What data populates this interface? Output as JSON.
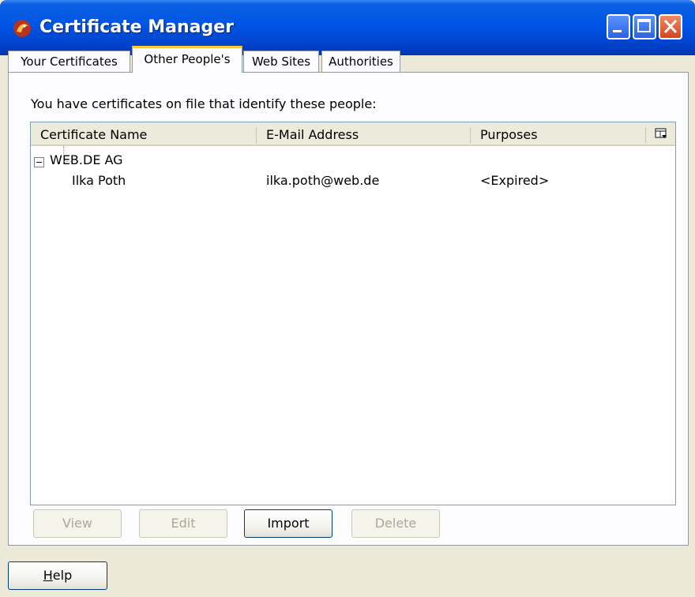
{
  "window": {
    "title": "Certificate Manager",
    "icon": "app-dragon-icon",
    "controls": {
      "minimize": "minimize-icon",
      "maximize": "maximize-icon",
      "close": "close-icon"
    }
  },
  "tabs": [
    {
      "label": "Your Certificates",
      "active": false
    },
    {
      "label": "Other People's",
      "active": true
    },
    {
      "label": "Web Sites",
      "active": false
    },
    {
      "label": "Authorities",
      "active": false
    }
  ],
  "panel": {
    "intro": "You have certificates on file that identify these people:",
    "columns": [
      {
        "label": "Certificate Name"
      },
      {
        "label": "E-Mail Address"
      },
      {
        "label": "Purposes"
      }
    ],
    "column_picker_icon": "column-picker-icon",
    "rows": [
      {
        "type": "group",
        "expanded": true,
        "name": "WEB.DE AG"
      },
      {
        "type": "item",
        "name": "Ilka Poth",
        "email": "ilka.poth@web.de",
        "purposes": "<Expired>"
      }
    ],
    "buttons": [
      {
        "label": "View",
        "enabled": false
      },
      {
        "label": "Edit",
        "enabled": false
      },
      {
        "label": "Import",
        "enabled": true
      },
      {
        "label": "Delete",
        "enabled": false
      }
    ]
  },
  "footer": {
    "help_label": "Help",
    "help_mnemonic": "H"
  },
  "colors": {
    "titlebar": "#0055e5",
    "window_bg": "#ece9d8",
    "active_tab_accent": "#ffc83c",
    "close_button": "#d5431c"
  }
}
